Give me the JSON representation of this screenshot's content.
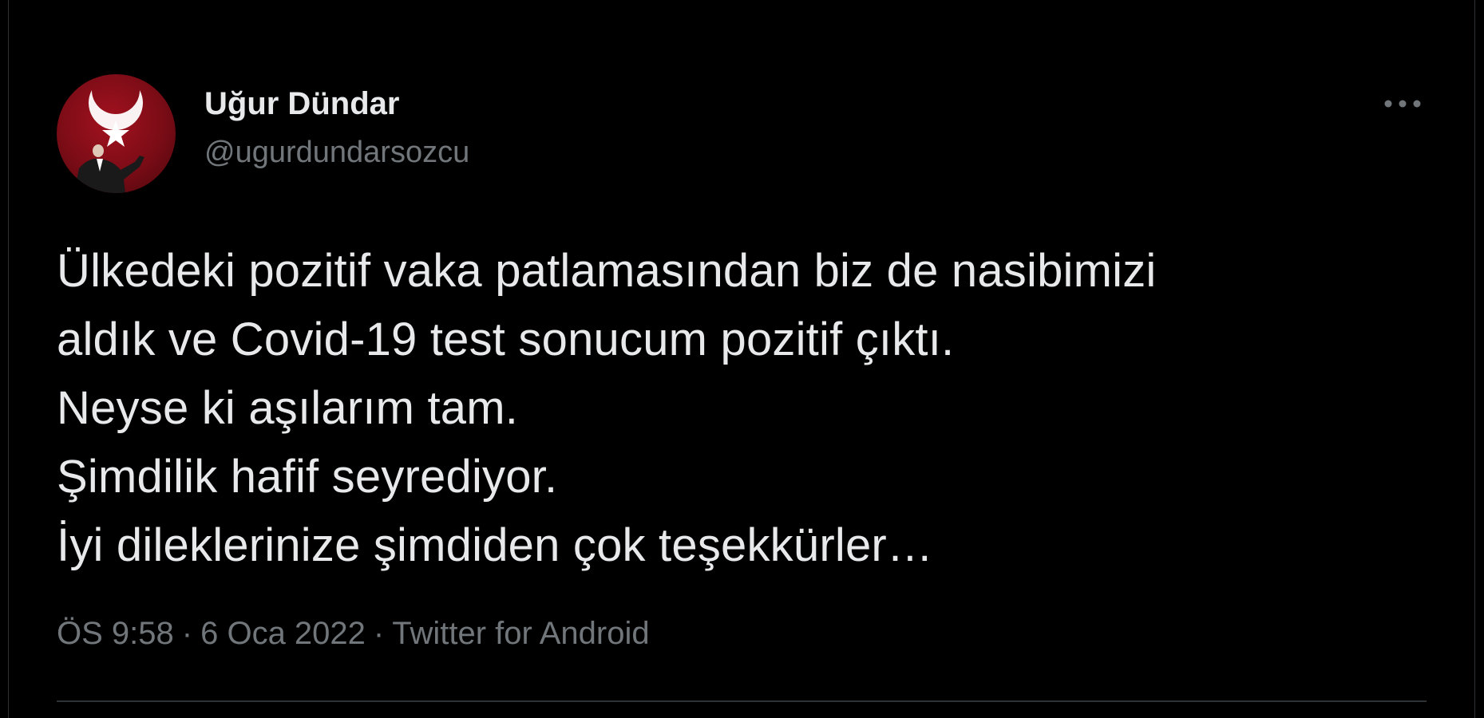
{
  "author": {
    "display_name": "Uğur Dündar",
    "handle": "@ugurdundarsozcu"
  },
  "avatar": {
    "icon": "avatar-turkish-flag-photo",
    "bg_color": "#8b0d18"
  },
  "more_icon": "ellipsis-icon",
  "tweet": {
    "lines": [
      "Ülkedeki pozitif vaka patlamasından biz de nasibimizi",
      "aldık ve Covid-19 test sonucum pozitif çıktı.",
      "Neyse ki aşılarım tam.",
      "Şimdilik hafif seyrediyor.",
      "İyi dileklerinize şimdiden çok teşekkürler…"
    ]
  },
  "meta": {
    "time": "ÖS 9:58",
    "separator": "·",
    "date": "6 Oca 2022",
    "source": "Twitter for Android"
  },
  "colors": {
    "background": "#000000",
    "text_primary": "#e7e9ea",
    "text_secondary": "#71767b",
    "divider": "#2f3336"
  }
}
